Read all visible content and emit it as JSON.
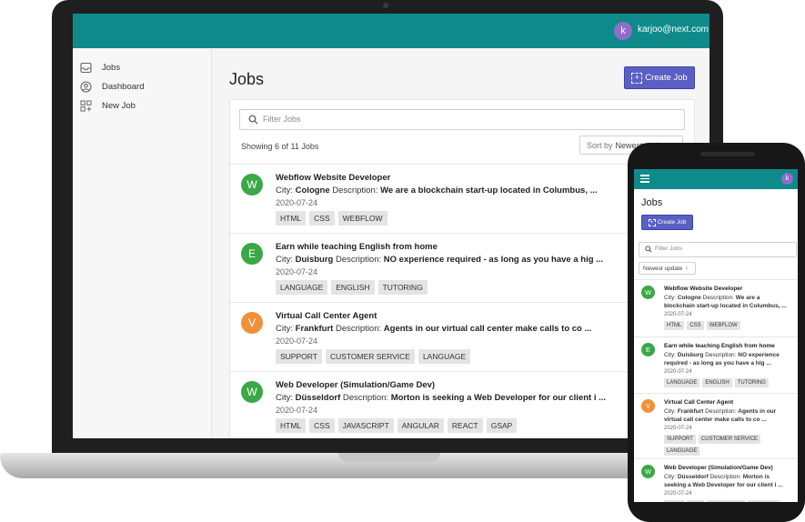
{
  "desktop": {
    "user": {
      "initial": "k",
      "email": "karjoo@next.com"
    },
    "sidebar": [
      {
        "label": "Jobs",
        "icon": "inbox-icon"
      },
      {
        "label": "Dashboard",
        "icon": "user-circle-icon"
      },
      {
        "label": "New Job",
        "icon": "add-grid-icon"
      }
    ],
    "title": "Jobs",
    "create_label": "Create Job",
    "search_placeholder": "Filter Jobs",
    "showing": "Showing 6 of 11 Jobs",
    "sort_prefix": "Sort by",
    "sort_value": "Newest update",
    "jobs": [
      {
        "initial": "W",
        "color": "#3aa845",
        "title": "Webflow Website Developer",
        "city": "Cologne",
        "description": "We are a blockchain start-up located in Columbus, ...",
        "date": "2020-07-24",
        "tags": [
          "HTML",
          "CSS",
          "WEBFLOW"
        ]
      },
      {
        "initial": "E",
        "color": "#3aa845",
        "title": "Earn while teaching English from home",
        "city": "Duisburg",
        "description": "NO experience required - as long as you have a hig ...",
        "date": "2020-07-24",
        "tags": [
          "LANGUAGE",
          "ENGLISH",
          "TUTORING"
        ]
      },
      {
        "initial": "V",
        "color": "#f0913a",
        "title": "Virtual Call Center Agent",
        "city": "Frankfurt",
        "description": "Agents in our virtual call center make calls to co ...",
        "date": "2020-07-24",
        "tags": [
          "SUPPORT",
          "CUSTOMER SERVICE",
          "LANGUAGE"
        ]
      },
      {
        "initial": "W",
        "color": "#3aa845",
        "title": "Web Developer (Simulation/Game Dev)",
        "city": "Düsseldorf",
        "description": "Morton is seeking a Web Developer for our client i ...",
        "date": "2020-07-24",
        "tags": [
          "HTML",
          "CSS",
          "JAVASCRIPT",
          "ANGULAR",
          "REACT",
          "GSAP"
        ]
      }
    ],
    "city_label": "City:",
    "description_label": "Description:"
  },
  "mobile": {
    "user_initial": "k",
    "title": "Jobs",
    "create_label": "Create Job",
    "search_placeholder": "Filter Jobs",
    "sort_value": "Newest update",
    "jobs": [
      {
        "initial": "W",
        "color": "#3aa845",
        "title": "Webflow Website Developer",
        "city": "Cologne",
        "description": "We are a blockchain start-up located in Columbus, ...",
        "date": "2020-07-24",
        "tags": [
          "HTML",
          "CSS",
          "WEBFLOW"
        ]
      },
      {
        "initial": "E",
        "color": "#3aa845",
        "title": "Earn while teaching English from home",
        "city": "Duisburg",
        "description": "NO experience required - as long as you have a hig ...",
        "date": "2020-07-24",
        "tags": [
          "LANGUAGE",
          "ENGLISH",
          "TUTORING"
        ]
      },
      {
        "initial": "V",
        "color": "#f0913a",
        "title": "Virtual Call Center Agent",
        "city": "Frankfurt",
        "description": "Agents in our virtual call center make calls to co ...",
        "date": "2020-07-24",
        "tags": [
          "SUPPORT",
          "CUSTOMER SERVICE",
          "LANGUAGE"
        ]
      },
      {
        "initial": "W",
        "color": "#3aa845",
        "title": "Web Developer (Simulation/Game Dev)",
        "city": "Düsseldorf",
        "description": "Morton is seeking a Web Developer for our client i ...",
        "date": "2020-07-24",
        "tags": [
          "HTML",
          "CSS",
          "JAVASCRIPT",
          "ANGULAR"
        ]
      }
    ]
  }
}
